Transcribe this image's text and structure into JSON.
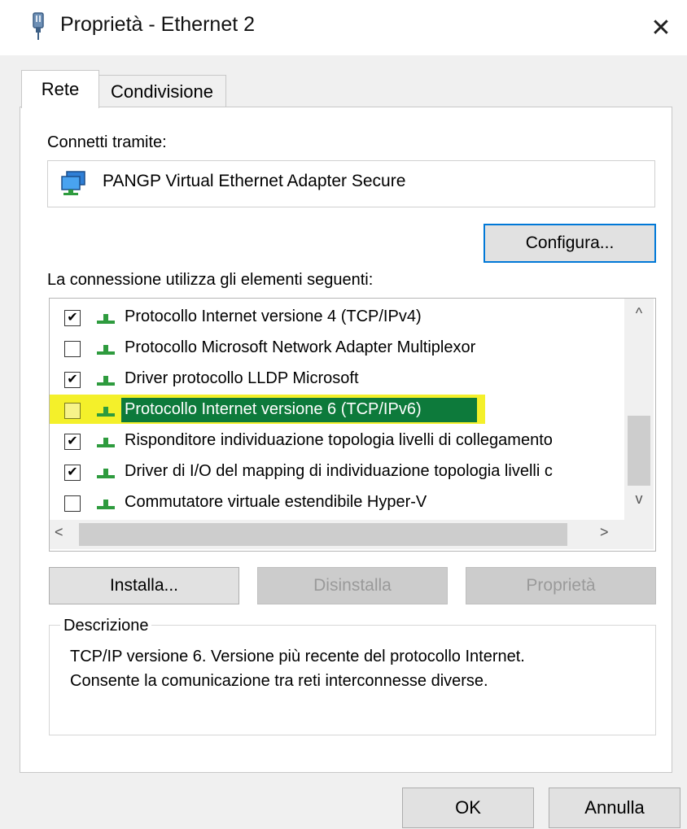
{
  "window": {
    "title": "Proprietà - Ethernet 2",
    "close_glyph": "✕"
  },
  "tabs": [
    {
      "label": "Rete",
      "active": true
    },
    {
      "label": "Condivisione",
      "active": false
    }
  ],
  "connection": {
    "label": "Connetti tramite:",
    "adapter": "PANGP Virtual Ethernet Adapter Secure",
    "adapter_icon": "network-adapter-icon",
    "configure_label": "Configura..."
  },
  "items_section": {
    "label": "La connessione utilizza gli elementi seguenti:",
    "items": [
      {
        "label": "Protocollo Internet versione 4 (TCP/IPv4)",
        "checked": true
      },
      {
        "label": "Protocollo Microsoft Network Adapter Multiplexor",
        "checked": false
      },
      {
        "label": "Driver protocollo LLDP Microsoft",
        "checked": true
      },
      {
        "label": "Protocollo Internet versione 6 (TCP/IPv6)",
        "checked": false,
        "highlighted": true
      },
      {
        "label": "Risponditore individuazione topologia livelli di collegamento",
        "checked": true
      },
      {
        "label": "Driver di I/O del mapping di individuazione topologia livelli c",
        "checked": true
      },
      {
        "label": "Commutatore virtuale estendibile Hyper-V",
        "checked": false
      }
    ],
    "checkmark_glyph": "✔",
    "scroll_up_glyph": "^",
    "scroll_down_glyph": "v",
    "scroll_left_glyph": "<",
    "scroll_right_glyph": ">"
  },
  "buttons": {
    "install": "Installa...",
    "uninstall": "Disinstalla",
    "properties": "Proprietà"
  },
  "description": {
    "legend": "Descrizione",
    "line1": "TCP/IP versione 6. Versione più recente del protocollo Internet.",
    "line2": "Consente la comunicazione tra reti interconnesse diverse."
  },
  "footer": {
    "ok": "OK",
    "cancel": "Annulla"
  },
  "colors": {
    "highlight_yellow": "#f4f02a",
    "highlight_green": "#0d7a3b",
    "accent_blue": "#0078d7"
  }
}
